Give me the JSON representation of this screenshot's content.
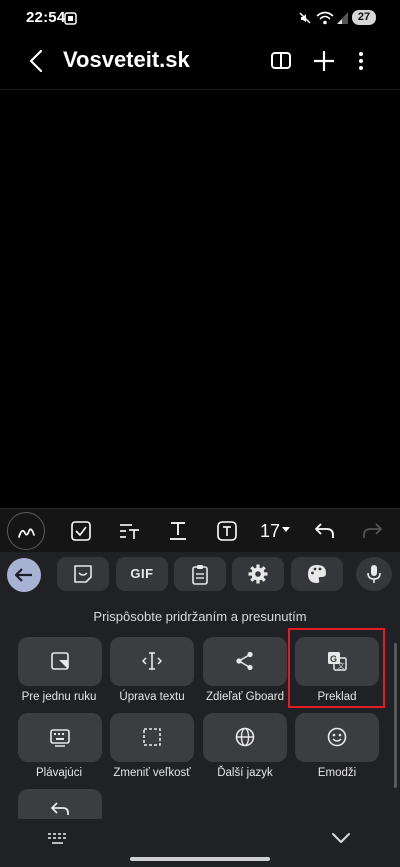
{
  "status_bar": {
    "time": "22:54",
    "battery": "27",
    "icons": [
      "screenshot-icon",
      "mute-icon",
      "wifi-icon",
      "signal-icon"
    ]
  },
  "app_bar": {
    "title": "Vosveteit.sk",
    "icons": [
      "back-arrow-icon",
      "book-icon",
      "plus-icon",
      "more-vert-icon"
    ]
  },
  "format_toolbar": {
    "font_size": "17",
    "icons": [
      "pen-icon",
      "checkbox-icon",
      "text-align-icon",
      "underline-text-icon",
      "text-box-icon",
      "undo-icon",
      "redo-icon"
    ]
  },
  "keyboard_toolbar": {
    "gif_label": "GIF",
    "icons": [
      "back-icon",
      "sticker-icon",
      "clipboard-icon",
      "settings-icon",
      "palette-icon",
      "mic-icon"
    ]
  },
  "keyboard_panel": {
    "hint": "Prispôsobte pridržaním a presunutím",
    "tiles": [
      {
        "label": "Pre jednu ruku",
        "icon": "one-hand-icon"
      },
      {
        "label": "Úprava textu",
        "icon": "text-cursor-icon"
      },
      {
        "label": "Zdieľať Gboard",
        "icon": "share-icon"
      },
      {
        "label": "Preklad",
        "icon": "translate-icon"
      },
      {
        "label": "Plávajúci",
        "icon": "floating-keyboard-icon"
      },
      {
        "label": "Zmeniť veľkosť",
        "icon": "resize-icon"
      },
      {
        "label": "Ďalší jazyk",
        "icon": "globe-icon"
      },
      {
        "label": "Emodži",
        "icon": "emoji-icon"
      },
      {
        "label": "",
        "icon": "undo-icon"
      }
    ]
  },
  "colors": {
    "background": "#000000",
    "keyboard_bg": "#202124",
    "tile_bg": "#3c3d41",
    "accent": "#a8b3d3",
    "highlight": "#e21b24"
  }
}
